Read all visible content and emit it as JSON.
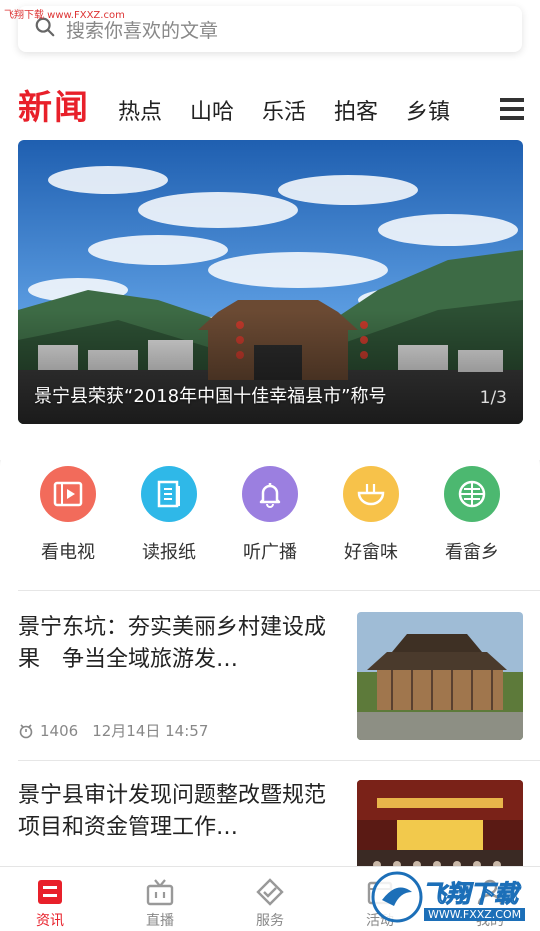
{
  "watermark": {
    "top_text": "飞翔下载 www.FXXZ.com",
    "logo_text": "飞翔下载",
    "logo_url": "WWW.FXXZ.COM"
  },
  "search": {
    "placeholder": "搜索你喜欢的文章",
    "icon": "search-icon"
  },
  "channels": {
    "brand": "新闻",
    "tabs": [
      {
        "label": "热点"
      },
      {
        "label": "山哈"
      },
      {
        "label": "乐活"
      },
      {
        "label": "拍客"
      },
      {
        "label": "乡镇"
      }
    ],
    "menu_icon": "menu-icon"
  },
  "banner": {
    "caption": "景宁县荣获“2018年中国十佳幸福县市”称号",
    "index": "1/3"
  },
  "quick_entries": [
    {
      "label": "看电视",
      "icon": "tv-icon",
      "color": "#f26b5b"
    },
    {
      "label": "读报纸",
      "icon": "newspaper-icon",
      "color": "#2fb8e8"
    },
    {
      "label": "听广播",
      "icon": "bell-icon",
      "color": "#9b7fe0"
    },
    {
      "label": "好畲味",
      "icon": "bowl-icon",
      "color": "#f7c24a"
    },
    {
      "label": "看畲乡",
      "icon": "emblem-icon",
      "color": "#4cb870"
    }
  ],
  "news": [
    {
      "title": "景宁东坑：夯实美丽乡村建设成果　争当全域旅游发…",
      "views": "1406",
      "date": "12月14日 14:57"
    },
    {
      "title": "景宁县审计发现问题整改暨规范项目和资金管理工作…"
    }
  ],
  "bottom_nav": [
    {
      "label": "资讯",
      "icon": "news-icon",
      "active": true
    },
    {
      "label": "直播",
      "icon": "tv-live-icon",
      "active": false
    },
    {
      "label": "服务",
      "icon": "service-icon",
      "active": false
    },
    {
      "label": "活动",
      "icon": "activity-icon",
      "active": false
    },
    {
      "label": "我的",
      "icon": "user-icon",
      "active": false
    }
  ],
  "colors": {
    "accent": "#e8202a"
  }
}
